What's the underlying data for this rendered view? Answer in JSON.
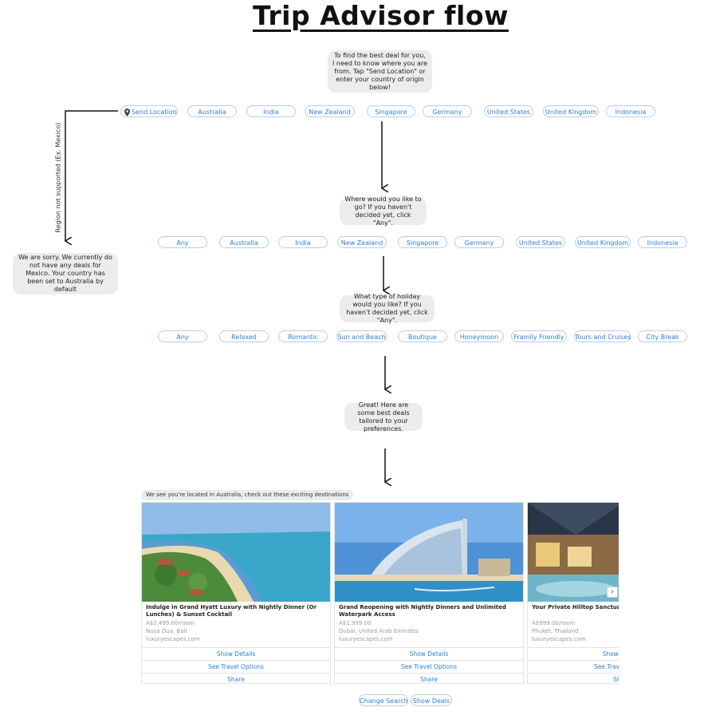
{
  "title": "Trip Advisor flow",
  "q1": "To find the best deal for you, I need to know where you are from. Tap \"Send Location\" or enter your country of origin below!",
  "origin_options": [
    "Send Location",
    "Australia",
    "India",
    "New Zealand",
    "Singapore",
    "Germany",
    "United States",
    "United Kingdom",
    "Indonesia"
  ],
  "unsupported_label": "Region not supported (Ex. Mexico)",
  "sorry_message": "We are sorry. We currently do not have any deals for Mexico. Your country has been set to Australia by default",
  "q2": "Where would you like to go? If you haven't decided yet, click \"Any\".",
  "destination_options": [
    "Any",
    "Australia",
    "India",
    "New Zealand",
    "Singapore",
    "Germany",
    "United States",
    "United Kingdom",
    "Indonesia"
  ],
  "q3": "What type of holiday would you like? If you haven't decided yet, click \"Any\".",
  "holiday_options": [
    "Any",
    "Relaxed",
    "Romantic",
    "Sun and Beach",
    "Boutique",
    "Honeymoon",
    "Framily Friendly",
    "Tours and Cruises",
    "City Break"
  ],
  "result_message": "Great! Here are some best deals tailored to your preferences.",
  "carousel_hint": "We see you're located in Australia, check out these exciting destinations",
  "cards": [
    {
      "title": "Indulge in Grand Hyatt Luxury with Nightly Dinner (Or Lunches) & Sunset Cocktail",
      "price": "A$2,499.00/room",
      "location": "Nusa Dua, Bali",
      "source": "luxuryescapes.com"
    },
    {
      "title": "Grand Reopening with Nightly Dinners and Unlimited Waterpark Access",
      "price": "A$1,999.00",
      "location": "Dubai, United Arab Emirates",
      "source": "luxuryescapes.com"
    },
    {
      "title": "Your Private Hilltop Sanctuary w Dinner, Massages &",
      "price": "A$999.00/room",
      "location": "Phuket, Thailand",
      "source": "luxuryescapes.com"
    }
  ],
  "card_buttons": {
    "details": "Show Details",
    "travel": "See Travel Options",
    "share": "Share"
  },
  "bottom_buttons": [
    "Change Search",
    "Show Deals"
  ],
  "colors": {
    "accent": "#2f80d6",
    "bubble": "#ececec"
  }
}
